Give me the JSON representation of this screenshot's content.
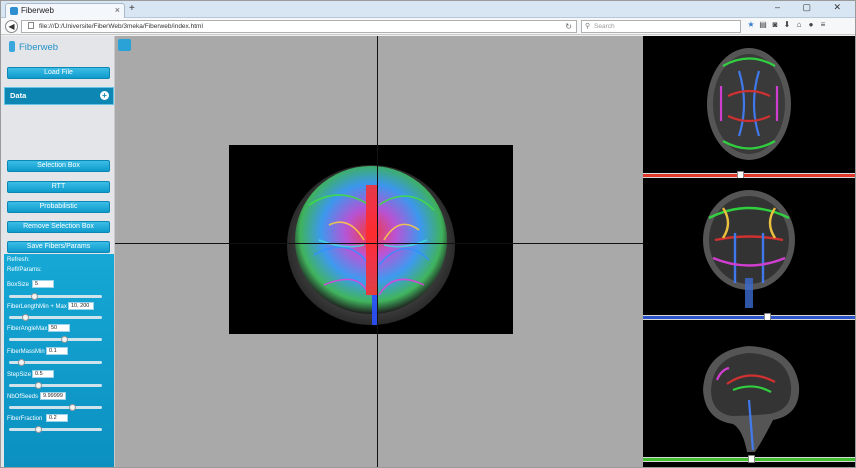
{
  "browser": {
    "tab_title": "Fiberweb",
    "tab_close": "×",
    "new_tab": "+",
    "window_controls": "–  ▢  ✕",
    "url": "file:///D:/Universite/FiberWeb/3meka/Fiberweb/index.html",
    "search_placeholder": "Search",
    "reload": "↻"
  },
  "sidebar": {
    "logo_text": "Fiberweb",
    "load_file": "Load File",
    "data_header": "Data",
    "data_plus": "+",
    "buttons": {
      "selection_box": "Selection Box",
      "rtt": "RTT",
      "probabilistic": "Probabilistic",
      "remove_selection_box": "Remove Selection Box",
      "save_fibers": "Save Fibers/Params"
    }
  },
  "params": {
    "title": "Refresh:",
    "subtitle": "Refl/Params:",
    "fields": [
      {
        "label": "BoxSize",
        "value": "5",
        "level": 0.25
      },
      {
        "label": "FiberLengthMin + Max",
        "value": "10, 200",
        "level": 0.15
      },
      {
        "label": "FiberAngleMax",
        "value": "50",
        "level": 0.6
      },
      {
        "label": "FiberMassMin",
        "value": "0.1",
        "level": 0.1
      },
      {
        "label": "StepSize",
        "value": "0.5",
        "level": 0.3
      },
      {
        "label": "NbOfSeeds",
        "value": "9.99999",
        "level": 0.7
      },
      {
        "label": "FiberFraction",
        "value": "0.2",
        "level": 0.3
      }
    ]
  },
  "slice_sliders": [
    {
      "color": "#e0392c",
      "level": 0.46
    },
    {
      "color": "#2b54c9",
      "level": 0.59
    },
    {
      "color": "#3fbf2f",
      "level": 0.51
    }
  ],
  "colors": {
    "accent": "#0e9fd2",
    "viewer_bg": "#a9a9a9"
  }
}
